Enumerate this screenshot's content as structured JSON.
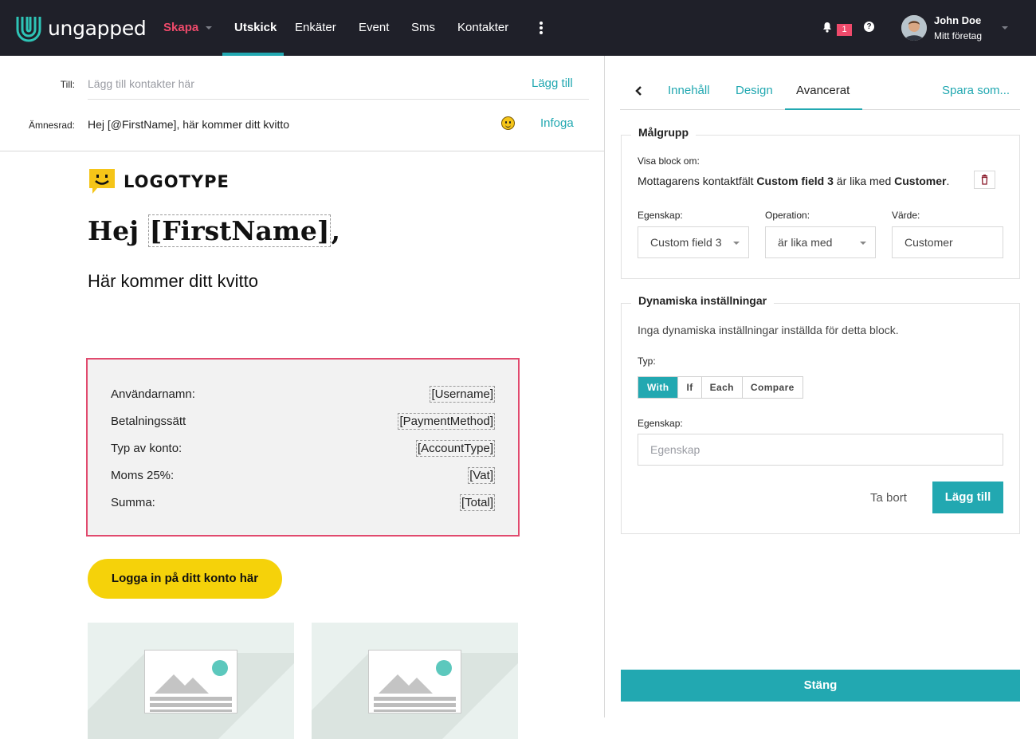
{
  "nav": {
    "brand": "ungapped",
    "create": "Skapa",
    "items": [
      "Utskick",
      "Enkäter",
      "Event",
      "Sms",
      "Kontakter"
    ],
    "notification_count": "1",
    "help": "?",
    "user_name": "John Doe",
    "user_company": "Mitt företag"
  },
  "compose": {
    "to_label": "Till:",
    "to_placeholder": "Lägg till kontakter här",
    "to_action": "Lägg till",
    "subject_label": "Ämnesrad:",
    "subject_value": "Hej [@FirstName], här kommer ditt kvitto",
    "subject_action": "Infoga"
  },
  "email": {
    "logotype": "LOGOTYPE",
    "greeting_prefix": "Hej ",
    "greeting_tag": "[FirstName]",
    "greeting_suffix": ",",
    "subheading": "Här kommer ditt kvitto",
    "receipt_rows": [
      {
        "key": "Användarnamn:",
        "value": "[Username]"
      },
      {
        "key": "Betalningssätt",
        "value": "[PaymentMethod]"
      },
      {
        "key": "Typ av konto:",
        "value": "[AccountType]"
      },
      {
        "key": "Moms 25%:",
        "value": "[Vat]"
      },
      {
        "key": "Summa:",
        "value": "[Total]"
      }
    ],
    "cta_label": "Logga in på ditt konto här"
  },
  "panel": {
    "tabs": [
      "Innehåll",
      "Design",
      "Avancerat"
    ],
    "save_as": "Spara som...",
    "audience": {
      "legend": "Målgrupp",
      "show_if_label": "Visa block om:",
      "rule_prefix": "Mottagarens kontaktfält ",
      "rule_field": "Custom field 3",
      "rule_mid": " är lika med ",
      "rule_value": "Customer",
      "rule_end": ".",
      "property_label": "Egenskap:",
      "property_value": "Custom field 3",
      "operation_label": "Operation:",
      "operation_value": "är lika med",
      "value_label": "Värde:",
      "value_value": "Customer"
    },
    "dynamic": {
      "legend": "Dynamiska inställningar",
      "empty_text": "Inga dynamiska inställningar inställda för detta block.",
      "type_label": "Typ:",
      "types": [
        "With",
        "If",
        "Each",
        "Compare"
      ],
      "property_label": "Egenskap:",
      "property_placeholder": "Egenskap",
      "remove_label": "Ta bort",
      "add_label": "Lägg till"
    },
    "close_label": "Stäng"
  },
  "colors": {
    "accent": "#22a8b1",
    "brand_pink": "#ef4a6b",
    "cta_yellow": "#f5d20a",
    "nav_bg": "#1f2029"
  }
}
